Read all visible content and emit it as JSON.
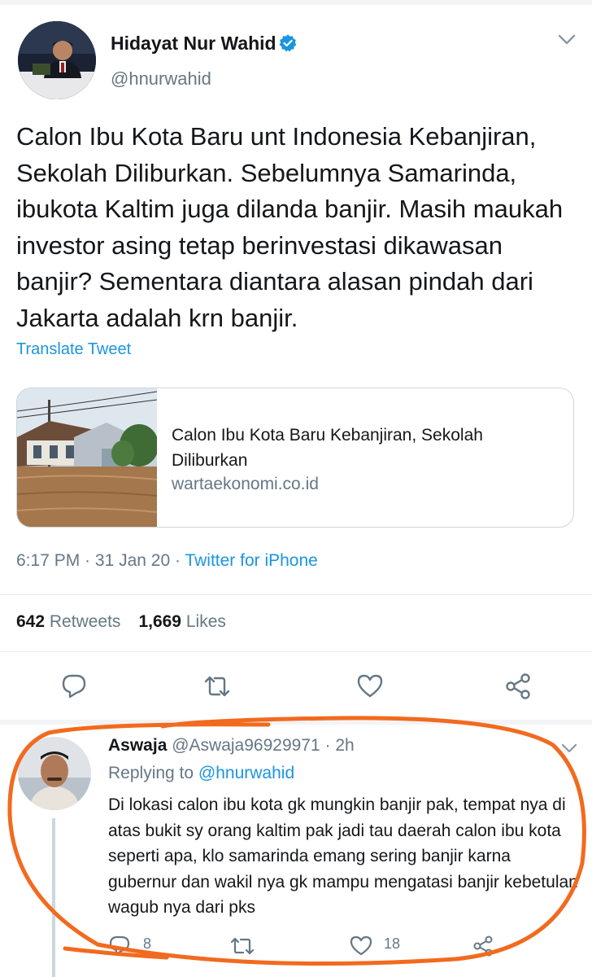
{
  "tweet": {
    "author": {
      "display_name": "Hidayat Nur Wahid",
      "handle": "@hnurwahid",
      "verified": true
    },
    "text": "Calon Ibu Kota Baru unt Indonesia Kebanjiran, Sekolah Diliburkan. Sebelumnya Samarinda, ibukota Kaltim juga dilanda banjir. Masih maukah investor asing tetap berinvestasi dikawasan banjir? Sementara diantara alasan pindah dari Jakarta adalah krn banjir.",
    "translate_label": "Translate Tweet",
    "link_card": {
      "title": "Calon Ibu Kota Baru Kebanjiran, Sekolah Diliburkan",
      "domain": "wartaekonomi.co.id"
    },
    "time": "6:17 PM",
    "separator": " · ",
    "date": "31 Jan 20",
    "source": "Twitter for iPhone",
    "stats": {
      "retweets_count": "642",
      "retweets_label": "Retweets",
      "likes_count": "1,669",
      "likes_label": "Likes"
    },
    "actions": [
      "reply-icon",
      "retweet-icon",
      "like-icon",
      "share-icon"
    ]
  },
  "reply": {
    "display_name": "Aswaja",
    "handle": "@Aswaja96929971",
    "separator": " · ",
    "time": "2h",
    "replying_prefix": "Replying to ",
    "replying_handle": "@hnurwahid",
    "text": "Di lokasi calon ibu kota gk mungkin banjir pak, tempat nya di atas bukit sy orang kaltim pak jadi tau daerah calon ibu kota seperti apa, klo samarinda emang sering banjir karna gubernur dan wakil nya gk mampu mengatasi banjir kebetulan wagub nya dari pks",
    "reply_count": "8",
    "like_count": "18"
  },
  "colors": {
    "link_blue": "#1b95e0",
    "muted_gray": "#657786",
    "text_dark": "#14171a",
    "highlight_orange": "#f26a1f"
  }
}
